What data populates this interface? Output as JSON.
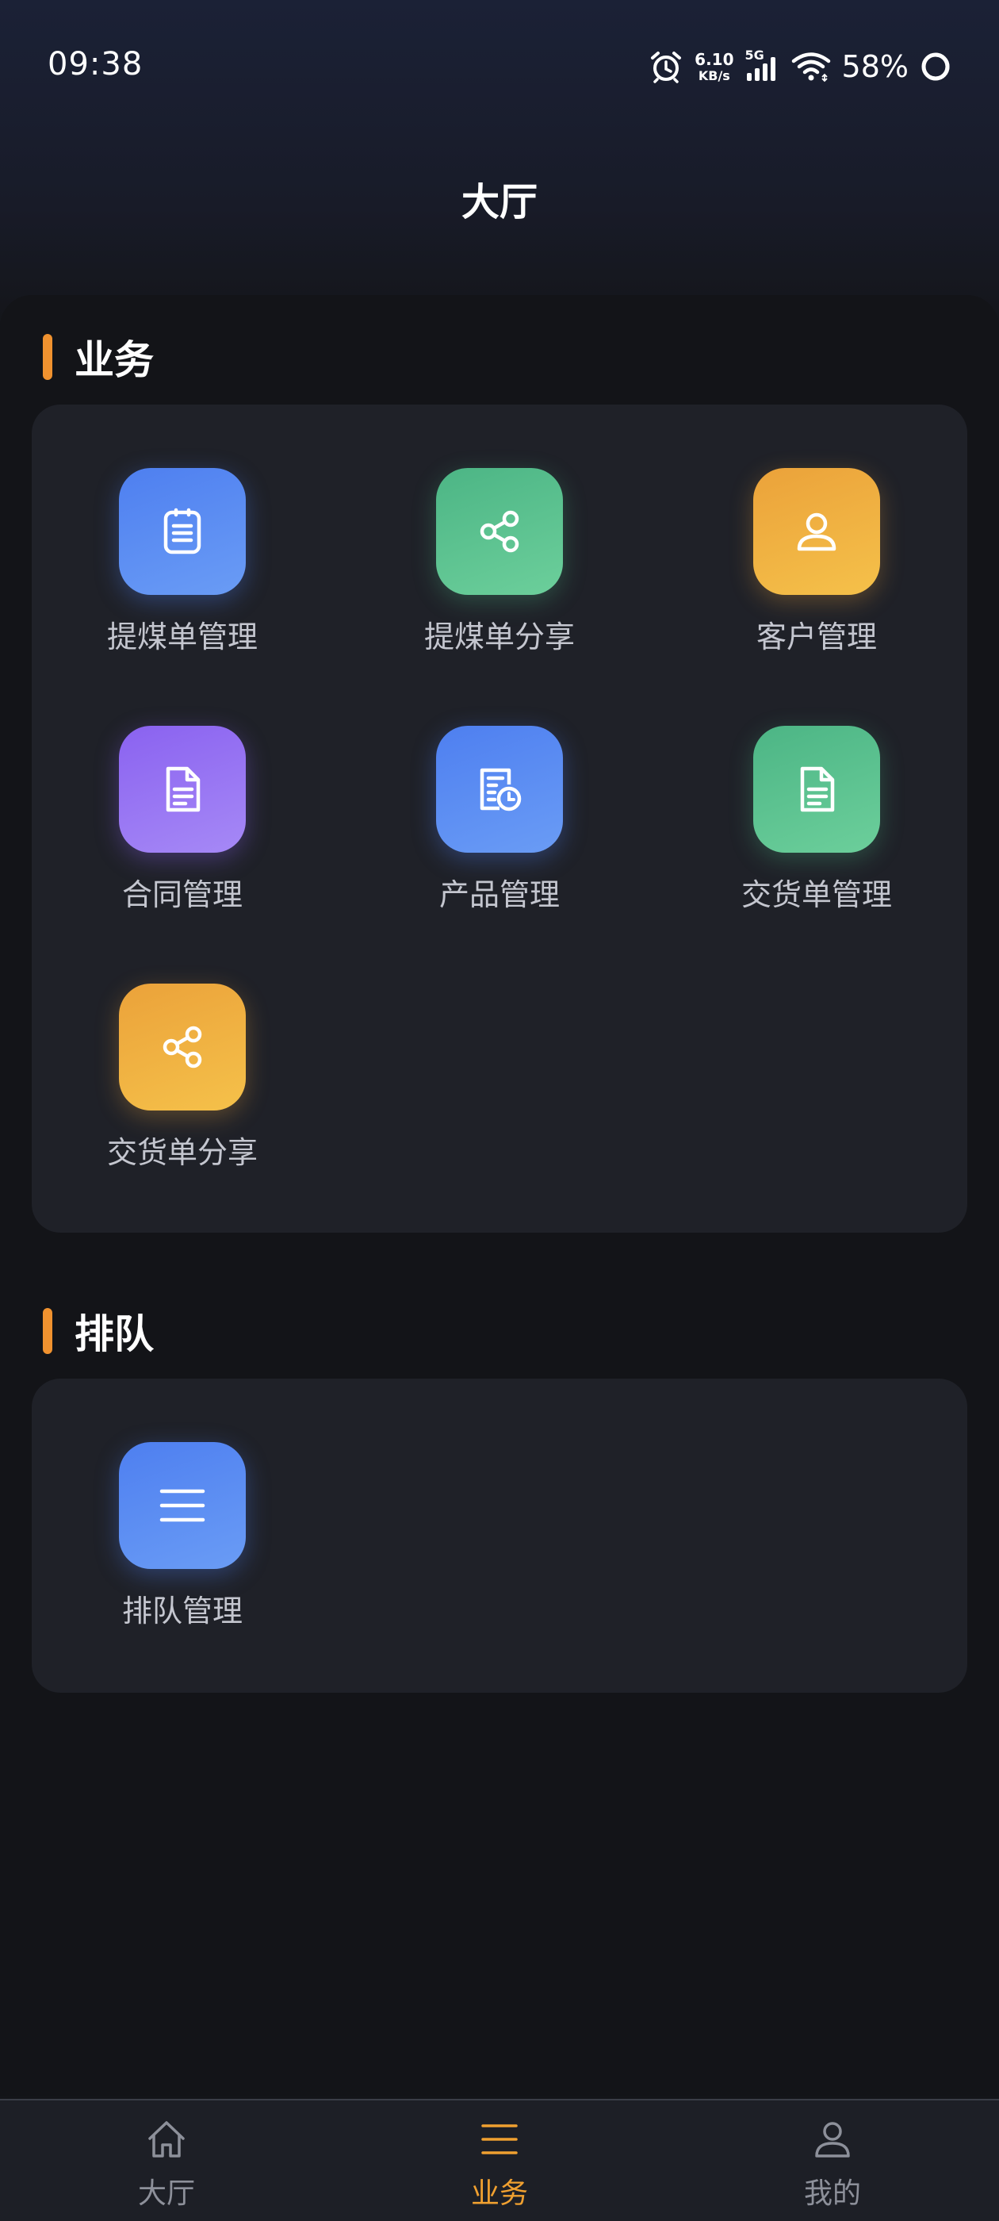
{
  "status_bar": {
    "time": "09:38",
    "net_speed_value": "6.10",
    "net_speed_unit": "KB/s",
    "network_type": "5G",
    "battery": "58%"
  },
  "header": {
    "title": "大厅"
  },
  "sections": {
    "business": {
      "title": "业务",
      "items": [
        {
          "label": "提煤单管理",
          "icon": "clipboard-list-icon",
          "color": "#5a8cf2"
        },
        {
          "label": "提煤单分享",
          "icon": "share-icon",
          "color": "#5bc290"
        },
        {
          "label": "客户管理",
          "icon": "user-icon",
          "color": "#f0b040"
        },
        {
          "label": "合同管理",
          "icon": "document-icon",
          "color": "#9472f2"
        },
        {
          "label": "产品管理",
          "icon": "document-clock-icon",
          "color": "#5a8cf2"
        },
        {
          "label": "交货单管理",
          "icon": "document-icon",
          "color": "#5bc290"
        },
        {
          "label": "交货单分享",
          "icon": "share-icon",
          "color": "#f0b040"
        }
      ]
    },
    "queue": {
      "title": "排队",
      "items": [
        {
          "label": "排队管理",
          "icon": "menu-icon",
          "color": "#5a8cf2"
        }
      ]
    }
  },
  "bottom_nav": {
    "active": "业务",
    "accent_color": "#f0a030",
    "items": [
      {
        "label": "大厅",
        "icon": "home-icon"
      },
      {
        "label": "业务",
        "icon": "menu-icon"
      },
      {
        "label": "我的",
        "icon": "user-icon"
      }
    ]
  }
}
